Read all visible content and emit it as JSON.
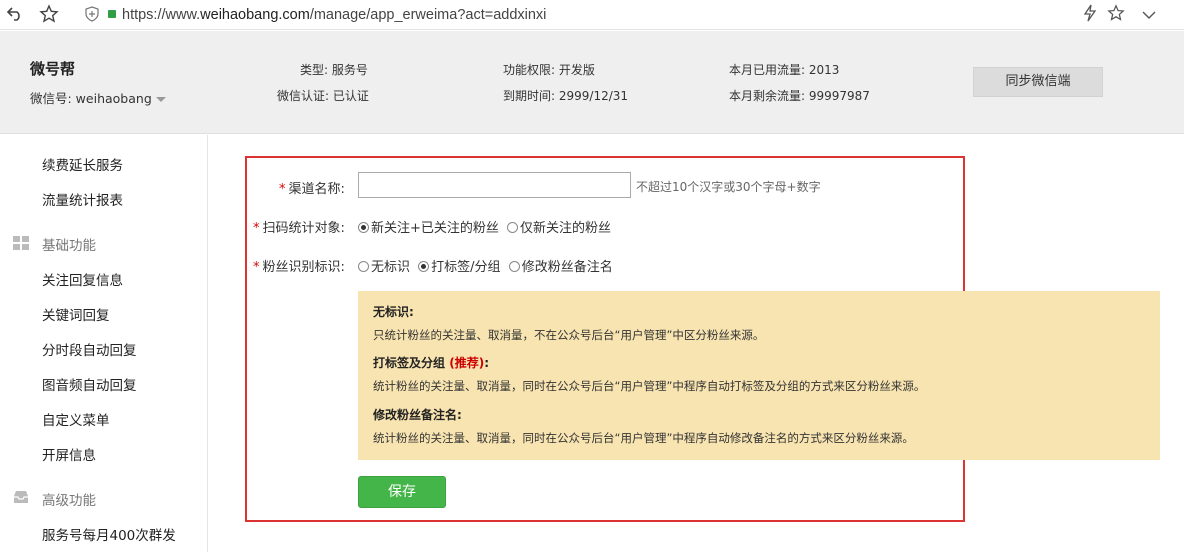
{
  "browser": {
    "url_prefix": "https://www.",
    "url_host": "weihaobang.com",
    "url_path": "/manage/app_erweima?act=addxinxi"
  },
  "header": {
    "brand": "微号帮",
    "wechat_id_label": "微信号: weihaobang",
    "type": "类型: 服务号",
    "verify": "微信认证: 已认证",
    "permission": "功能权限: 开发版",
    "expire": "到期时间: 2999/12/31",
    "used_traffic": "本月已用流量: 2013",
    "remaining_traffic": "本月剩余流量: 99997987",
    "sync_button": "同步微信端"
  },
  "sidebar": {
    "items_top": [
      "续费延长服务",
      "流量统计报表"
    ],
    "cat_basic": "基础功能",
    "items_basic": [
      "关注回复信息",
      "关键词回复",
      "分时段自动回复",
      "图音频自动回复",
      "自定义菜单",
      "开屏信息"
    ],
    "cat_advanced": "高级功能",
    "items_advanced": [
      "服务号每月400次群发"
    ]
  },
  "form": {
    "required_mark": "*",
    "channel_label": "渠道名称:",
    "channel_value": "",
    "channel_hint": "不超过10个汉字或30个字母+数字",
    "scan_label": "扫码统计对象:",
    "scan_options": [
      "新关注+已关注的粉丝",
      "仅新关注的粉丝"
    ],
    "scan_selected": 0,
    "fan_label": "粉丝识别标识:",
    "fan_options": [
      "无标识",
      "打标签/分组",
      "修改粉丝备注名"
    ],
    "fan_selected": 1
  },
  "note": {
    "t1": "无标识:",
    "d1": "只统计粉丝的关注量、取消量，不在公众号后台“用户管理”中区分粉丝来源。",
    "t2": "打标签及分组",
    "t2_rec": "(推荐)",
    "t2_colon": ":",
    "d2": "统计粉丝的关注量、取消量，同时在公众号后台“用户管理”中程序自动打标签及分组的方式来区分粉丝来源。",
    "t3": "修改粉丝备注名:",
    "d3": "统计粉丝的关注量、取消量，同时在公众号后台“用户管理”中程序自动修改备注名的方式来区分粉丝来源。"
  },
  "save_button": "保存"
}
